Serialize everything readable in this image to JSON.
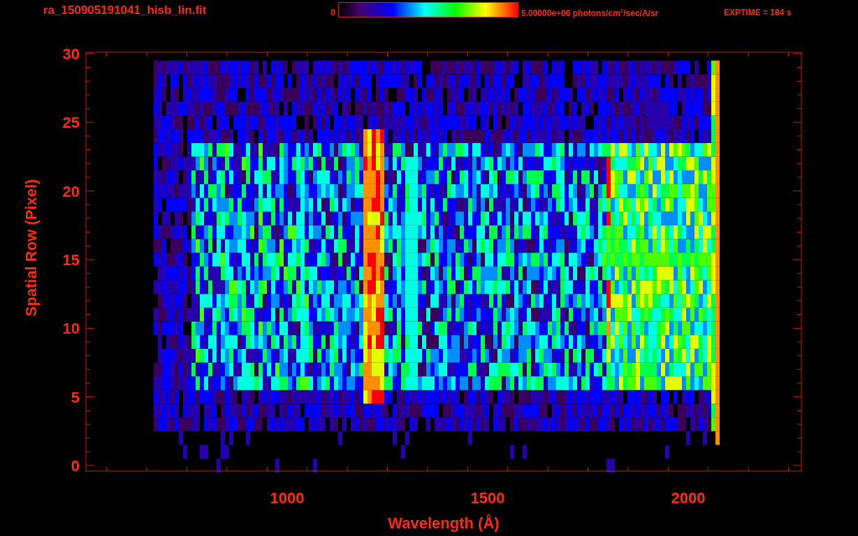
{
  "title": "ra_150905191041_hisb_lin.fit",
  "colorbar": {
    "min_label": "0",
    "max_label": "5.00000e+06 photons/cm$^{2}$/sec/A/sr"
  },
  "exposure": "EXPTIME = 184 s",
  "plot": {
    "x_axis": {
      "label": "Wavelength (Å)",
      "ticks": [
        "1000",
        "1500",
        "2000"
      ]
    },
    "y_axis": {
      "label": "Spatial Row (Pixel)",
      "ticks": [
        "30",
        "25",
        "20",
        "15",
        "10",
        "5",
        "0"
      ]
    }
  }
}
